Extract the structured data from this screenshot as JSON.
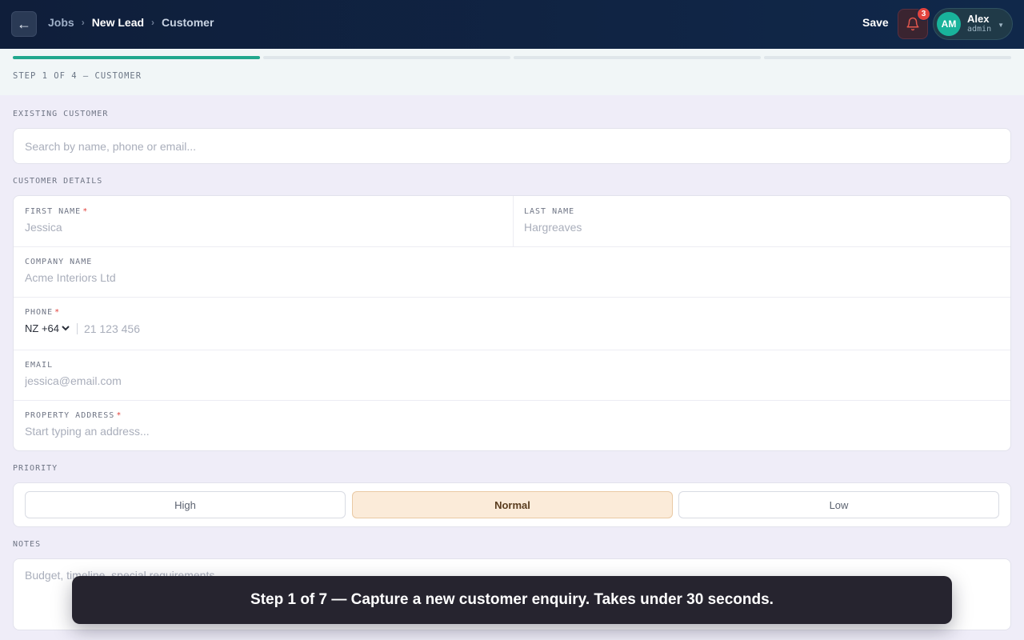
{
  "header": {
    "breadcrumbs": [
      "Jobs",
      "New Lead",
      "Customer"
    ],
    "save_label": "Save",
    "notification_count": "3",
    "user": {
      "initials": "AM",
      "name": "Alex",
      "role": "admin"
    }
  },
  "progress": {
    "steps_total": 4,
    "steps_done": 1,
    "label": "STEP 1 OF 4 — CUSTOMER"
  },
  "existing_customer": {
    "label": "EXISTING CUSTOMER",
    "placeholder": "Search by name, phone or email..."
  },
  "customer_details": {
    "label": "CUSTOMER DETAILS",
    "first_name": {
      "label": "FIRST NAME",
      "placeholder": "Jessica"
    },
    "last_name": {
      "label": "LAST NAME",
      "placeholder": "Hargreaves"
    },
    "company_name": {
      "label": "COMPANY NAME",
      "placeholder": "Acme Interiors Ltd"
    },
    "phone": {
      "label": "PHONE",
      "country": "NZ +64",
      "placeholder": "21 123 456"
    },
    "email": {
      "label": "EMAIL",
      "placeholder": "jessica@email.com"
    },
    "address": {
      "label": "PROPERTY ADDRESS",
      "placeholder": "Start typing an address..."
    },
    "required_mark": "*"
  },
  "priority": {
    "label": "PRIORITY",
    "options": [
      "High",
      "Normal",
      "Low"
    ],
    "selected": "Normal"
  },
  "notes": {
    "label": "NOTES",
    "placeholder": "Budget, timeline, special requirements..."
  },
  "toast": {
    "message": "Step 1 of 7 — Capture a new customer enquiry. Takes under 30 seconds."
  },
  "colors": {
    "header_bg": "#0f1e3a",
    "accent_teal": "#22a88e",
    "selected_priority": "#fbebd9",
    "badge_red": "#e2433d"
  }
}
